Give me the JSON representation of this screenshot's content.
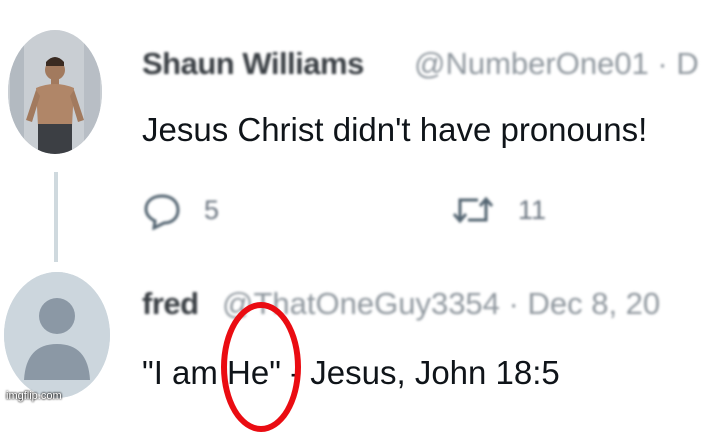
{
  "tweet1": {
    "name": "Shaun Williams",
    "handle": "@NumberOne01 · D",
    "text": "Jesus Christ didn't have pronouns!",
    "reply_count": "5",
    "retweet_count": "11"
  },
  "tweet2": {
    "name": "fred",
    "handle": "@ThatOneGuy3354 · Dec 8, 20",
    "text": "\"I am He\" - Jesus, John 18:5"
  },
  "watermark": "imgflip.com",
  "colors": {
    "annotation_circle": "#ea0c12",
    "muted": "#536471"
  }
}
